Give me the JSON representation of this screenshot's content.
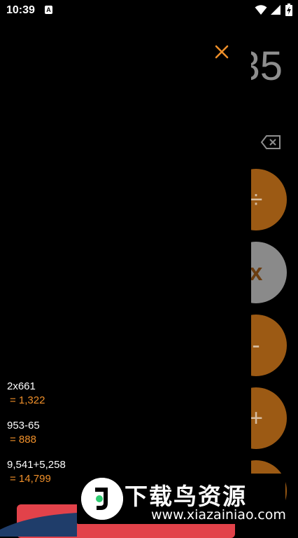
{
  "status_bar": {
    "time": "10:39",
    "notification_icon": "a-badge-icon",
    "wifi_icon": "wifi-icon",
    "signal_icon": "signal-icon",
    "battery_icon": "battery-charging-icon"
  },
  "calculator": {
    "display_partial": "35",
    "backspace_icon": "backspace-icon",
    "buttons": [
      {
        "label": "÷",
        "color": "#9c5a14"
      },
      {
        "label": "x",
        "color": "#8a8a8a"
      },
      {
        "label": "-",
        "color": "#9c5a14"
      },
      {
        "label": "+",
        "color": "#9c5a14"
      },
      {
        "label": "",
        "color": "#9c5a14"
      }
    ]
  },
  "history": {
    "close_icon": "close-icon",
    "accent_color": "#f0902a",
    "items": [
      {
        "expression": "2x661",
        "result": "= 1,322"
      },
      {
        "expression": "953-65",
        "result": "= 888"
      },
      {
        "expression": "9,541+5,258",
        "result": "= 14,799"
      }
    ],
    "clear_button_color": "#e2424a"
  },
  "watermark": {
    "title": "下载鸟资源",
    "url": "www.xiazainiao.com"
  }
}
